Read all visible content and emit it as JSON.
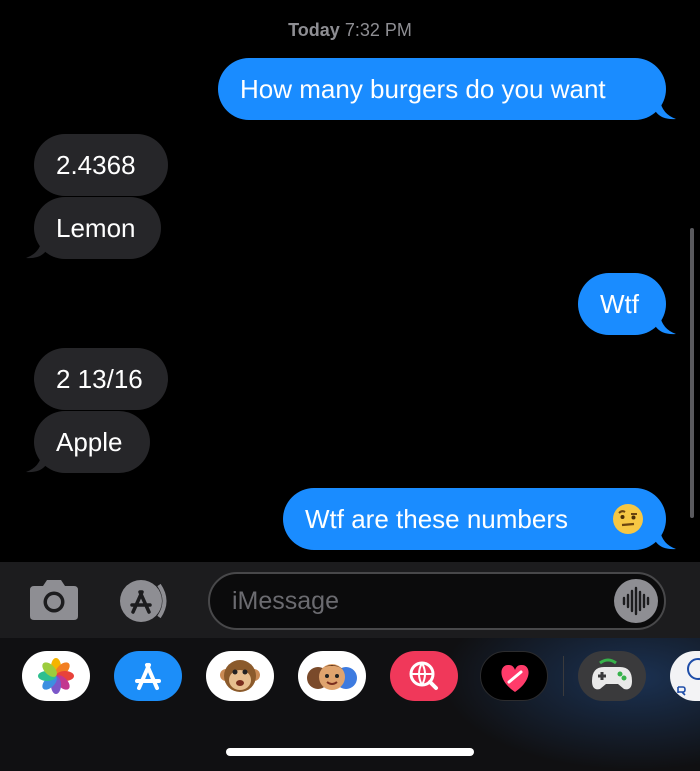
{
  "header": {
    "day": "Today",
    "time": "7:32 PM"
  },
  "messages": [
    {
      "sender": "me",
      "text": "How many burgers do you want"
    },
    {
      "sender": "them",
      "text": "2.4368"
    },
    {
      "sender": "them",
      "text": "Lemon"
    },
    {
      "sender": "me",
      "text": "Wtf"
    },
    {
      "sender": "them",
      "text": "2 13/16"
    },
    {
      "sender": "them",
      "text": "Apple"
    },
    {
      "sender": "me",
      "text": "Wtf are these numbers",
      "emoji": "raised-eyebrow-face"
    }
  ],
  "composer": {
    "placeholder": "iMessage"
  },
  "icons": {
    "camera": "camera-icon",
    "app_store": "app-store-icon",
    "audio": "audio-waveform-icon"
  },
  "app_tray": [
    {
      "name": "photos",
      "icon": "photos-icon"
    },
    {
      "name": "app-store",
      "icon": "app-store-icon"
    },
    {
      "name": "animoji",
      "icon": "monkey-animoji-icon"
    },
    {
      "name": "memoji",
      "icon": "memoji-stickers-icon"
    },
    {
      "name": "images-search",
      "icon": "globe-search-icon"
    },
    {
      "name": "digital-touch",
      "icon": "heart-icon"
    },
    {
      "name": "game",
      "icon": "game-controller-icon"
    },
    {
      "name": "partial-app",
      "icon": "partial-app-icon"
    }
  ],
  "colors": {
    "background": "#000000",
    "outgoing_bubble": "#1a8cff",
    "incoming_bubble": "#262629",
    "timestamp": "#8e8e93"
  }
}
